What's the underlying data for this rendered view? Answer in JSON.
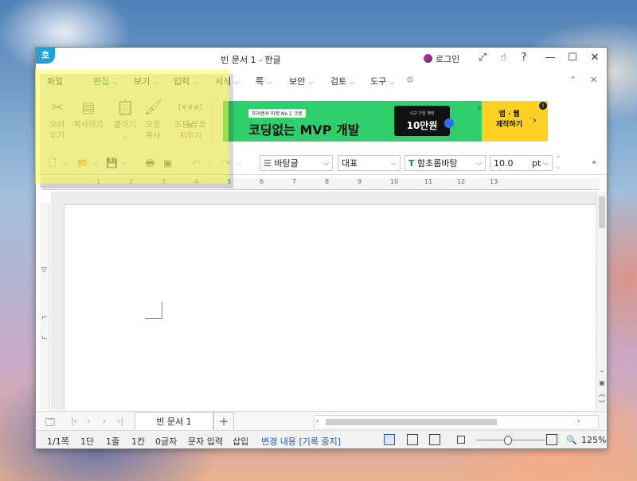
{
  "window": {
    "title": "빈 문서 1 - 한글",
    "app_icon_glyph": "호",
    "login_label": "로그인"
  },
  "menu": {
    "items": [
      {
        "label": "파일",
        "chev": false
      },
      {
        "label": "편집",
        "chev": true,
        "active": true
      },
      {
        "label": "보기",
        "chev": true
      },
      {
        "label": "입력",
        "chev": true
      },
      {
        "label": "서식",
        "chev": true
      },
      {
        "label": "쪽",
        "chev": true
      },
      {
        "label": "보안",
        "chev": true
      },
      {
        "label": "검토",
        "chev": true
      },
      {
        "label": "도구",
        "chev": true
      }
    ]
  },
  "ribbon": {
    "cut": [
      "오려",
      "두기"
    ],
    "copy": [
      "복사하기"
    ],
    "paste": [
      "붙이기"
    ],
    "format_copy": [
      "모양",
      "복사"
    ],
    "clear_codes": [
      "조판 부호",
      "지우기"
    ],
    "clear_codes_icon_text": "[###]"
  },
  "ad": {
    "tag": "프리랜서 마켓 No.1 크몽",
    "main": "코딩없는 MVP 개발",
    "dark_small": "신규 가입 혜택",
    "dark_big": "10만원",
    "logo": "kmong",
    "cta": [
      "앱 · 웹",
      "제작하기"
    ],
    "info": "i"
  },
  "toolbar": {
    "style": "바탕글",
    "lang": "대표",
    "font_icon": "T",
    "font": "함초롬바탕",
    "size": "10.0",
    "unit": "pt"
  },
  "ruler": {
    "numbers": [
      "1",
      "2",
      "3",
      "4",
      "5",
      "6",
      "7",
      "8",
      "9",
      "10",
      "11",
      "12",
      "13"
    ]
  },
  "tabs": {
    "doc_tab": "빈 문서 1",
    "add": "+"
  },
  "status": {
    "page": "1/1쪽",
    "section": "1단",
    "line": "1줄",
    "column": "1칸",
    "chars": "0글자",
    "mode": "문자 입력",
    "insert": "삽입",
    "track": "변경 내용 [기록 중지]",
    "zoom": "125%"
  },
  "colors": {
    "highlight": "#ffff50",
    "ad_green": "#2fcf6d",
    "ad_yellow": "#ffd024",
    "menu_active": "#1a7a3a"
  }
}
